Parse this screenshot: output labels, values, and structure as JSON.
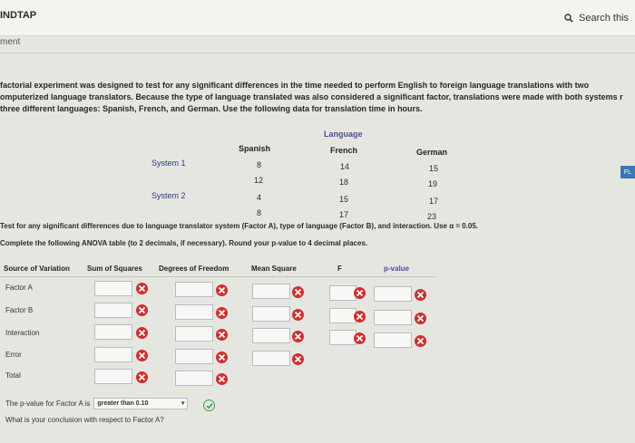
{
  "header": {
    "brand": "INDTAP",
    "search_label": "Search this",
    "section": "ment"
  },
  "problem_text": "factorial experiment was designed to test for any significant differences in the time needed to perform English to foreign language translations with two omputerized language translators. Because the type of language translated was also considered a significant factor, translations were made with both systems r three different languages: Spanish, French, and German. Use the following data for translation time in hours.",
  "data_table": {
    "language_label": "Language",
    "columns": [
      "Spanish",
      "French",
      "German"
    ],
    "rows": [
      {
        "system": "System 1",
        "values": [
          [
            "8",
            "12"
          ],
          [
            "14",
            "18"
          ],
          [
            "15",
            "19"
          ]
        ]
      },
      {
        "system": "System 2",
        "values": [
          [
            "4",
            "8"
          ],
          [
            "15",
            "17"
          ],
          [
            "17",
            "23"
          ]
        ]
      }
    ]
  },
  "side_tab": "FL",
  "instructions": {
    "line1": "Test for any significant differences due to language translator system (Factor A), type of language (Factor B), and interaction. Use α = 0.05.",
    "line2": "Complete the following ANOVA table (to 2 decimals, if necessary). Round your p-value to 4 decimal places."
  },
  "anova": {
    "headers": {
      "source": "Source of Variation",
      "ss": "Sum of Squares",
      "df": "Degrees of Freedom",
      "ms": "Mean Square",
      "f": "F",
      "p": "p-value"
    },
    "rows": [
      {
        "label": "Factor A",
        "ss": "",
        "df": "",
        "ms": "",
        "f": "",
        "p": ""
      },
      {
        "label": "Factor B",
        "ss": "",
        "df": "",
        "ms": "",
        "f": "",
        "p": ""
      },
      {
        "label": "Interaction",
        "ss": "",
        "df": "",
        "ms": "",
        "f": "",
        "p": ""
      },
      {
        "label": "Error",
        "ss": "",
        "df": "",
        "ms": ""
      },
      {
        "label": "Total",
        "ss": "",
        "df": ""
      }
    ],
    "status_colors": {
      "wrong": "#d42d2d",
      "correct": "#3aa04a"
    }
  },
  "question1": {
    "text": "The p-value for Factor A is",
    "selected": "greater than 0.10"
  },
  "question2": {
    "text": "What is your conclusion with respect to Factor A?"
  }
}
